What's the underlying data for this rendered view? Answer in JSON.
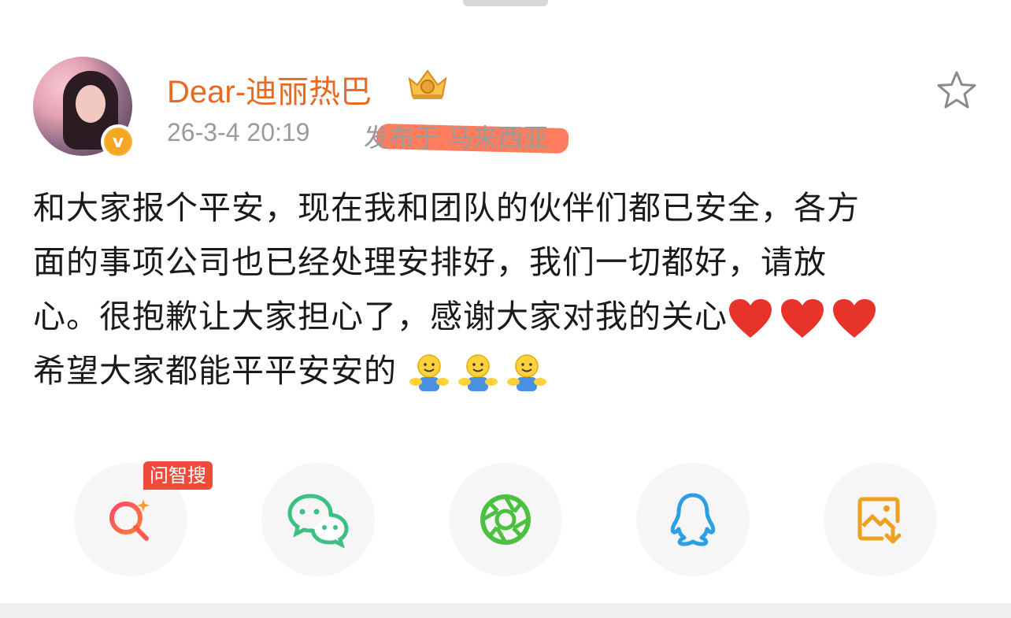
{
  "post": {
    "username": "Dear-迪丽热巴",
    "timestamp": "26-3-4 20:19",
    "location": "发布于 马来西亚",
    "text_lines": [
      "和大家报个平安，现在我和团队的伙伴们都已安全，各方",
      "面的事项公司也已经处理安排好，我们一切都好，请放",
      "心。很抱歉让大家担心了，感谢大家对我的关心",
      "希望大家都能平平安安的"
    ]
  },
  "share": {
    "ask_badge": "问智搜",
    "buttons": [
      "ask-search-icon",
      "wechat-icon",
      "moments-icon",
      "qq-icon",
      "save-image-icon"
    ]
  },
  "colors": {
    "username": "#e86a22",
    "timestamp": "#9b9b9b",
    "wechat": "#3cc083",
    "moments": "#4cc040",
    "qq": "#2b9fe6",
    "save": "#f0a020",
    "heart": "#e8332a"
  }
}
